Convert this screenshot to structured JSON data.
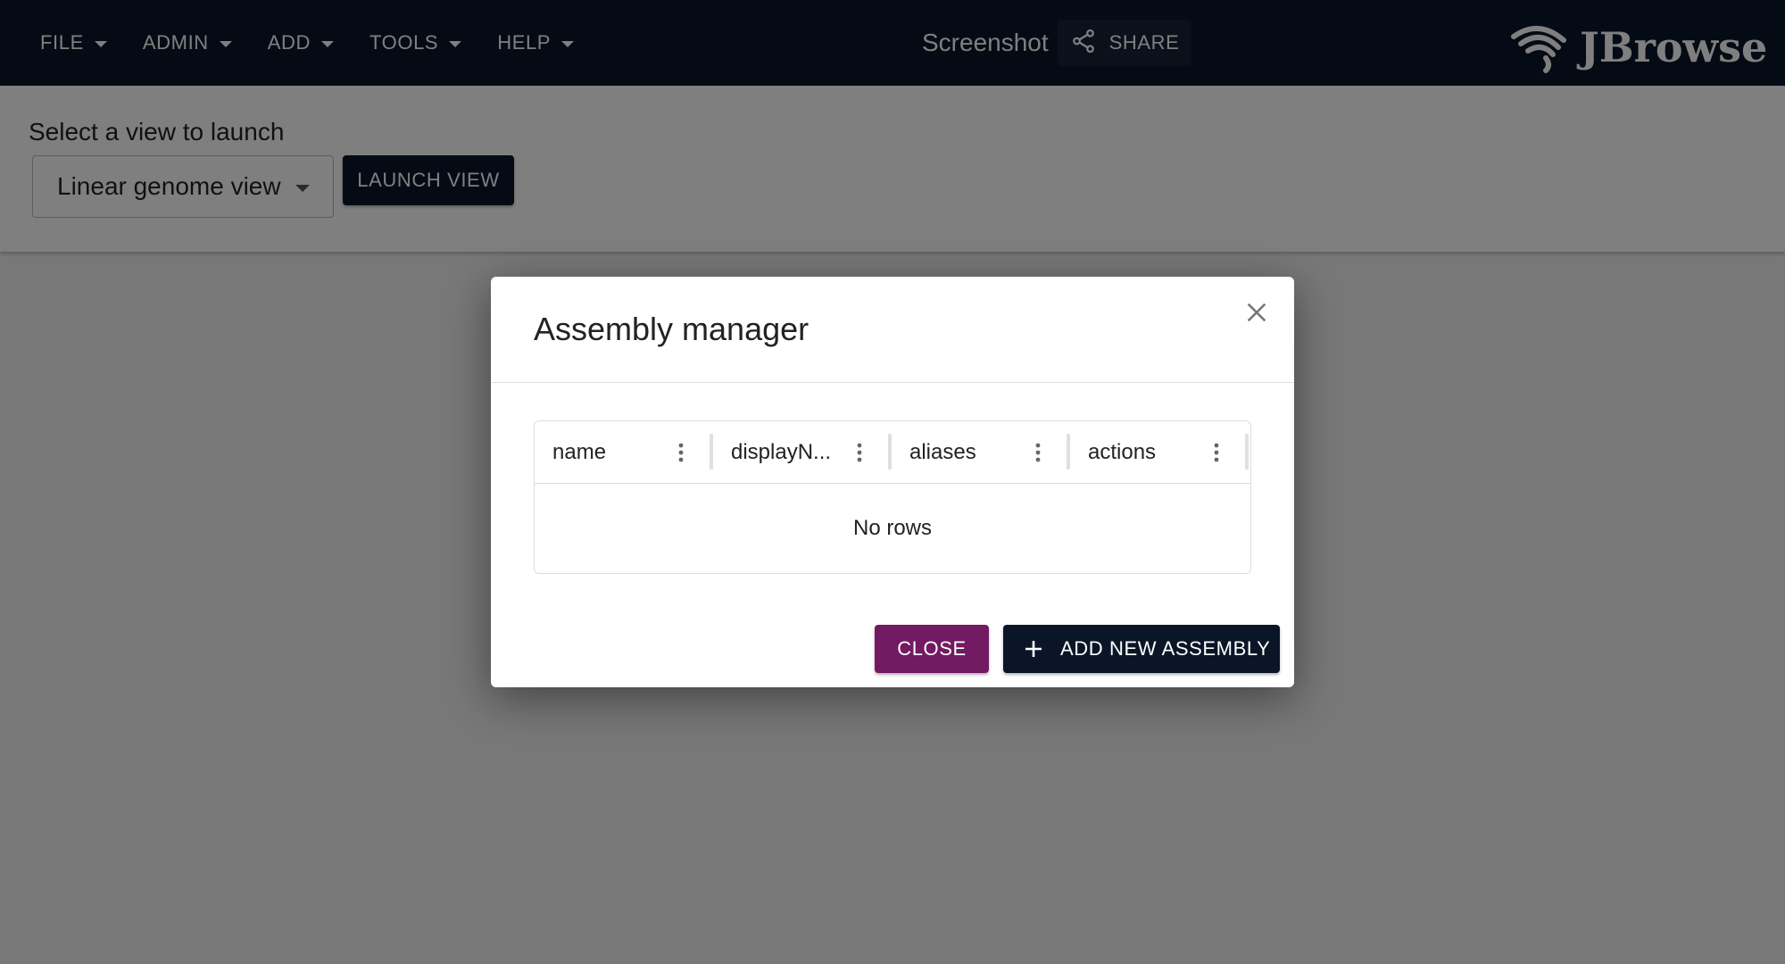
{
  "appbar": {
    "menus": [
      {
        "label": "FILE"
      },
      {
        "label": "ADMIN"
      },
      {
        "label": "ADD"
      },
      {
        "label": "TOOLS"
      },
      {
        "label": "HELP"
      }
    ],
    "session_name": "Screenshot",
    "share_label": "SHARE",
    "logo_text": "JBrowse",
    "background_color": "#0a1628"
  },
  "launcher": {
    "label": "Select a view to launch",
    "selected_view": "Linear genome view",
    "launch_button": "LAUNCH VIEW"
  },
  "dialog": {
    "title": "Assembly manager",
    "columns": [
      {
        "title": "name"
      },
      {
        "title": "displayN..."
      },
      {
        "title": "aliases"
      },
      {
        "title": "actions"
      }
    ],
    "empty_text": "No rows",
    "close_button": "CLOSE",
    "add_button": "ADD NEW ASSEMBLY",
    "close_button_color": "#721a62",
    "add_button_color": "#0a1628"
  }
}
